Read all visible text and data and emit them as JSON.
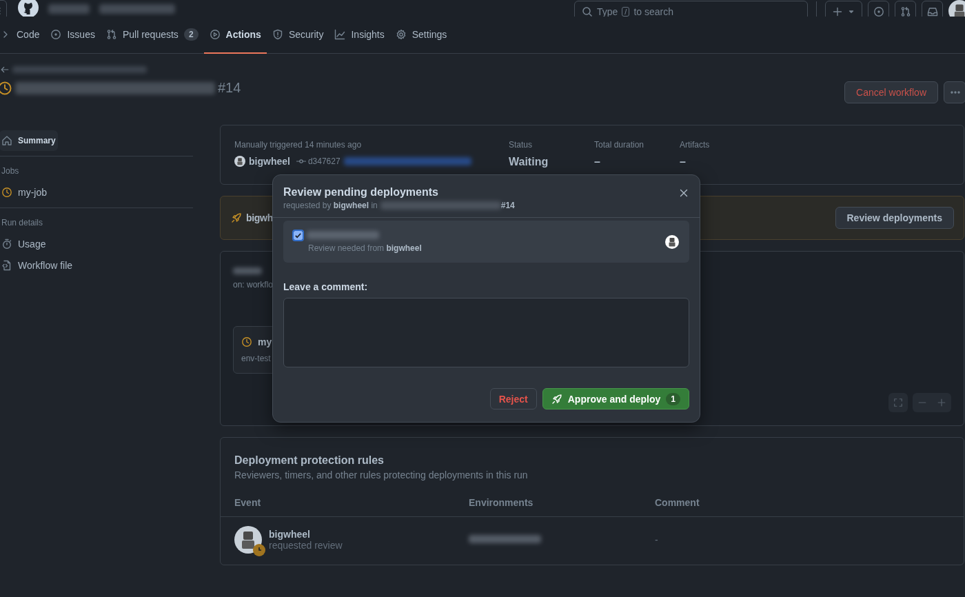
{
  "header": {
    "search": {
      "placeholder_before": "Type",
      "key": "/",
      "placeholder_after": "to search"
    }
  },
  "repo_tabs": [
    {
      "label": "Code",
      "selected": false
    },
    {
      "label": "Issues",
      "selected": false
    },
    {
      "label": "Pull requests",
      "count": "2",
      "selected": false
    },
    {
      "label": "Actions",
      "selected": true
    },
    {
      "label": "Security",
      "selected": false
    },
    {
      "label": "Insights",
      "selected": false
    },
    {
      "label": "Settings",
      "selected": false
    }
  ],
  "run": {
    "number": "#14",
    "cancel_button": "Cancel workflow"
  },
  "sidebar": {
    "items": [
      {
        "label": "Summary",
        "selected": true
      }
    ],
    "sections": [
      {
        "title": "Jobs",
        "items": [
          {
            "label": "my-job",
            "selected": false
          }
        ]
      },
      {
        "title": "Run details",
        "items": [
          {
            "label": "Usage",
            "selected": false
          },
          {
            "label": "Workflow file",
            "selected": false
          }
        ]
      }
    ]
  },
  "summary": {
    "trigger": "Manually triggered 14 minutes ago",
    "actor": "bigwheel",
    "commit": "d347627",
    "stats": [
      {
        "label": "Status",
        "value": "Waiting"
      },
      {
        "label": "Total duration",
        "value": "–"
      },
      {
        "label": "Artifacts",
        "value": "–"
      }
    ]
  },
  "banner": {
    "text": "bigwh",
    "button": "Review deployments"
  },
  "graph": {
    "trigger": "on: workflo",
    "job": {
      "name": "my",
      "environment": "env-test"
    }
  },
  "protection": {
    "title": "Deployment protection rules",
    "subtitle": "Reviewers, timers, and other rules protecting deployments in this run",
    "columns": [
      "Event",
      "Environments",
      "Comment"
    ],
    "rows": [
      {
        "actor": "bigwheel",
        "action": "requested review",
        "comment": "-"
      }
    ]
  },
  "modal": {
    "title": "Review pending deployments",
    "subtitle": "requested by **bigwheel** in",
    "run_number": "#14",
    "environments": [
      {
        "note": "Review needed from **bigwheel**",
        "checked": true
      }
    ],
    "comment_label": "Leave a comment:",
    "reject_button": "Reject",
    "approve_button": "Approve and deploy",
    "approve_count": "1"
  }
}
